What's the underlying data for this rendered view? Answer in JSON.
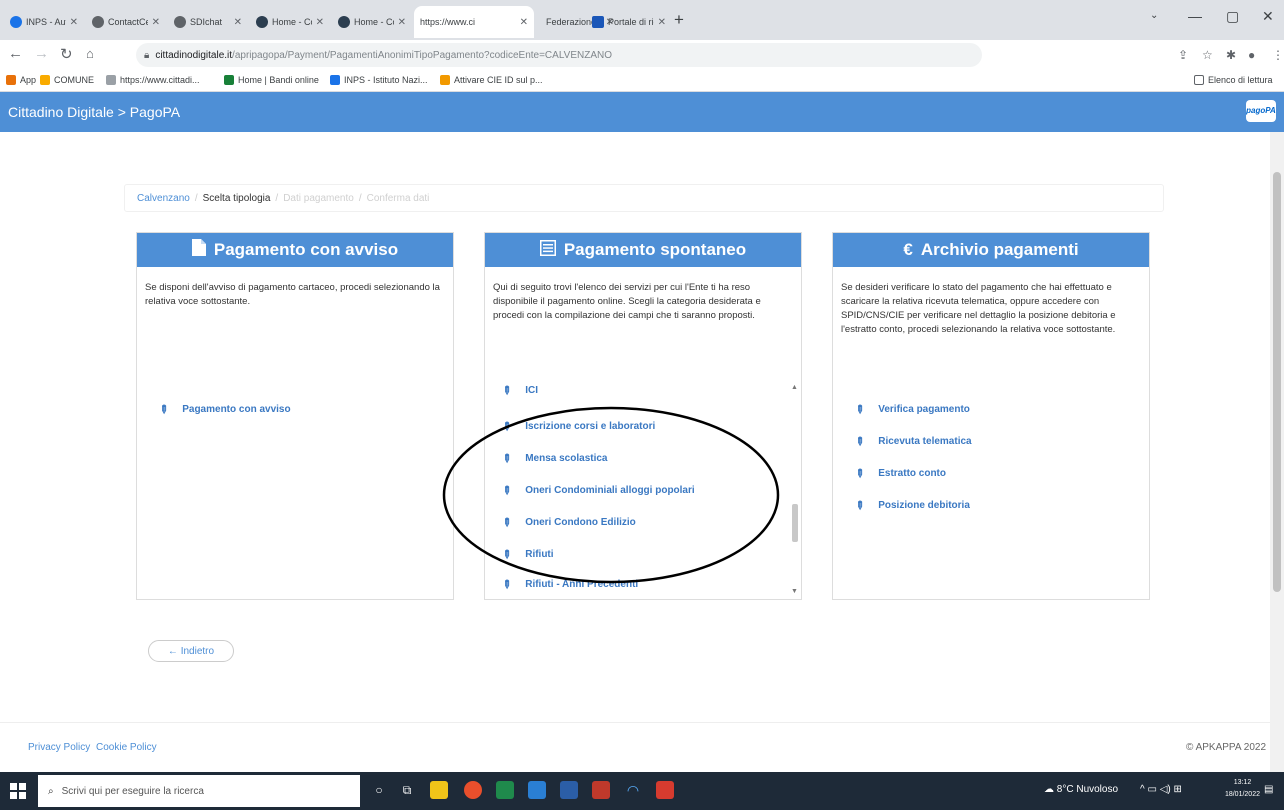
{
  "browser": {
    "tabs": [
      {
        "label": "INPS - Autent",
        "color": "#1a73e8"
      },
      {
        "label": "ContactCenter",
        "color": "#5f6368"
      },
      {
        "label": "SDIchat",
        "color": "#5f6368"
      },
      {
        "label": "Home - Comu",
        "color": "#2c3e50"
      },
      {
        "label": "Home - Comu",
        "color": "#2c3e50"
      },
      {
        "label": "https://www.ci",
        "color": "#5f6368"
      },
      {
        "label": "Federazione",
        "color": "#c0392b"
      },
      {
        "label": "Portale di ricti",
        "color": "#1a56b8"
      }
    ],
    "url_host": "cittadinodigitale.it",
    "url_path": "/apripagopa/Payment/PagamentiAnonimiTipoPagamento?codiceEnte=CALVENZANO",
    "bookmarks": [
      {
        "label": "App",
        "color": "#e8710a"
      },
      {
        "label": "COMUNE",
        "color": "#f9ab00"
      },
      {
        "label": "https://www.cittadi...",
        "color": "#9aa0a6"
      },
      {
        "label": "Home | Bandi online",
        "color": "#188038"
      },
      {
        "label": "INPS - Istituto Nazi...",
        "color": "#1a73e8"
      },
      {
        "label": "Attivare CIE ID sul p...",
        "color": "#f29900"
      }
    ],
    "reading_list": "Elenco di lettura"
  },
  "app": {
    "title": "Cittadino Digitale > PagoPA",
    "logo": "pagoPA"
  },
  "breadcrumb": {
    "ente": "Calvenzano",
    "step_current": "Scelta tipologia",
    "step_next1": "Dati pagamento",
    "step_next2": "Conferma dati"
  },
  "panels": {
    "avviso": {
      "title": "Pagamento con avviso",
      "icon": "file-icon",
      "description": "Se disponi dell'avviso di pagamento cartaceo, procedi selezionando la relativa voce sottostante.",
      "links": [
        "Pagamento con avviso"
      ]
    },
    "spontaneo": {
      "title": "Pagamento spontaneo",
      "icon": "list-icon",
      "description": "Qui di seguito trovi l'elenco dei servizi per cui l'Ente ti ha reso disponibile il pagamento online. Scegli la categoria desiderata e procedi con la compilazione dei campi che ti saranno proposti.",
      "services": [
        "ICI",
        "Iscrizione corsi e laboratori",
        "Mensa scolastica",
        "Oneri Condominiali alloggi popolari",
        "Oneri Condono Edilizio",
        "Rifiuti",
        "Rifiuti - Anni Precedenti"
      ]
    },
    "archivio": {
      "title": "Archivio pagamenti",
      "icon": "euro-icon",
      "description": "Se desideri verificare lo stato del pagamento che hai effettuato e scaricare la relativa ricevuta telematica, oppure accedere con SPID/CNS/CIE per verificare nel dettaglio la posizione debitoria e l'estratto conto, procedi selezionando la relativa voce sottostante.",
      "links": [
        "Verifica pagamento",
        "Ricevuta telematica",
        "Estratto conto",
        "Posizione debitoria"
      ]
    }
  },
  "back_label": "← Indietro",
  "footer": {
    "privacy": "Privacy Policy",
    "cookie": "Cookie Policy",
    "copyright": "© APKAPPA 2022"
  },
  "taskbar": {
    "search_placeholder": "Scrivi qui per eseguire la ricerca",
    "weather": "8°C Nuvoloso",
    "time": "13:12",
    "date": "18/01/2022"
  },
  "colors": {
    "primary": "#4e8fd6",
    "link": "#3a78c2"
  }
}
